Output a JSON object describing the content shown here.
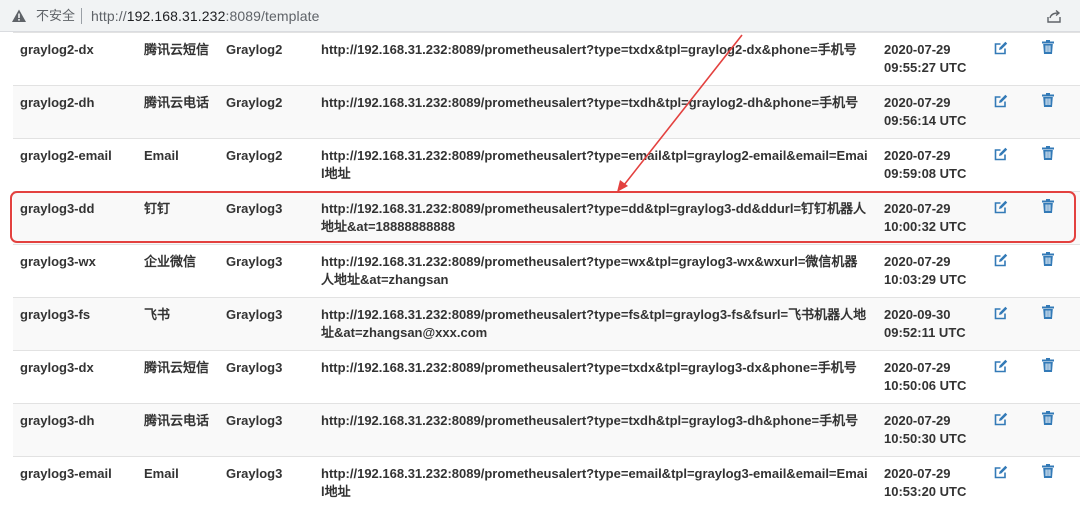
{
  "browser": {
    "insecure_label": "不安全",
    "url_prefix": "http://",
    "url_host": "192.168.31.232",
    "url_suffix": ":8089/template"
  },
  "table": {
    "rows": [
      {
        "name": "graylog2-dx",
        "type": "腾讯云短信",
        "group": "Graylog2",
        "url": "http://192.168.31.232:8089/prometheusalert?type=txdx&tpl=graylog2-dx&phone=手机号",
        "date": "2020-07-29",
        "time": "09:55:27 UTC"
      },
      {
        "name": "graylog2-dh",
        "type": "腾讯云电话",
        "group": "Graylog2",
        "url": "http://192.168.31.232:8089/prometheusalert?type=txdh&tpl=graylog2-dh&phone=手机号",
        "date": "2020-07-29",
        "time": "09:56:14 UTC"
      },
      {
        "name": "graylog2-email",
        "type": "Email",
        "group": "Graylog2",
        "url": "http://192.168.31.232:8089/prometheusalert?type=email&tpl=graylog2-email&email=Email地址",
        "date": "2020-07-29",
        "time": "09:59:08 UTC"
      },
      {
        "name": "graylog3-dd",
        "type": "钉钉",
        "group": "Graylog3",
        "url": "http://192.168.31.232:8089/prometheusalert?type=dd&tpl=graylog3-dd&ddurl=钉钉机器人地址&at=18888888888",
        "date": "2020-07-29",
        "time": "10:00:32 UTC"
      },
      {
        "name": "graylog3-wx",
        "type": "企业微信",
        "group": "Graylog3",
        "url": "http://192.168.31.232:8089/prometheusalert?type=wx&tpl=graylog3-wx&wxurl=微信机器人地址&at=zhangsan",
        "date": "2020-07-29",
        "time": "10:03:29 UTC"
      },
      {
        "name": "graylog3-fs",
        "type": "飞书",
        "group": "Graylog3",
        "url": "http://192.168.31.232:8089/prometheusalert?type=fs&tpl=graylog3-fs&fsurl=飞书机器人地址&at=zhangsan@xxx.com",
        "date": "2020-09-30",
        "time": "09:52:11 UTC"
      },
      {
        "name": "graylog3-dx",
        "type": "腾讯云短信",
        "group": "Graylog3",
        "url": "http://192.168.31.232:8089/prometheusalert?type=txdx&tpl=graylog3-dx&phone=手机号",
        "date": "2020-07-29",
        "time": "10:50:06 UTC"
      },
      {
        "name": "graylog3-dh",
        "type": "腾讯云电话",
        "group": "Graylog3",
        "url": "http://192.168.31.232:8089/prometheusalert?type=txdh&tpl=graylog3-dh&phone=手机号",
        "date": "2020-07-29",
        "time": "10:50:30 UTC"
      },
      {
        "name": "graylog3-email",
        "type": "Email",
        "group": "Graylog3",
        "url": "http://192.168.31.232:8089/prometheusalert?type=email&tpl=graylog3-email&email=Email地址",
        "date": "2020-07-29",
        "time": "10:53:20 UTC"
      }
    ]
  },
  "icons": {
    "edit": "edit-icon",
    "delete": "trash-icon",
    "warning": "warning-icon",
    "share": "share-icon"
  },
  "colors": {
    "action_icon": "#337ab7",
    "highlight": "#e3413f",
    "row_stripe": "#f9f9f9"
  }
}
